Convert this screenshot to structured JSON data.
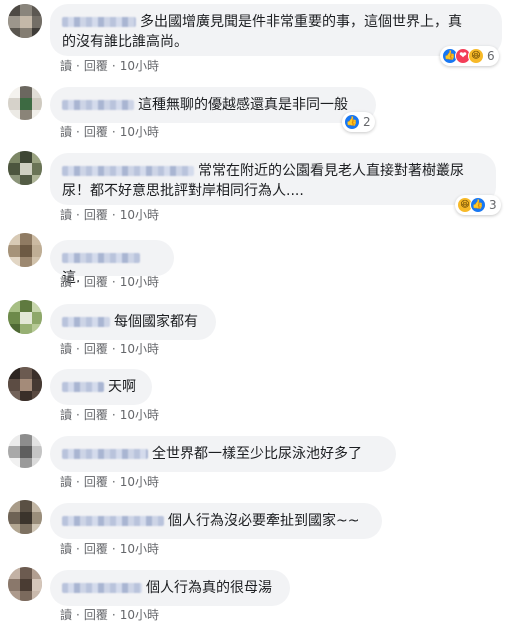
{
  "actions": {
    "read": "讀",
    "reply": "回覆",
    "separator": "·",
    "time": "10小時"
  },
  "comments": [
    {
      "text_line1": "多出國增廣見聞是件非常重要的事，這個世界上，真",
      "text_line2": "的沒有誰比誰高尚。",
      "reaction_count": "6"
    },
    {
      "text": "這種無聊的優越感還真是非同一般",
      "reaction_count": "2"
    },
    {
      "text_line1": "常常在附近的公園看見老人直接對著樹叢尿",
      "text_line2": "尿！都不好意思批評對岸相同行為人....",
      "reaction_count": "3"
    },
    {
      "text": "這."
    },
    {
      "text": "每個國家都有"
    },
    {
      "text": "天啊"
    },
    {
      "text": "全世界都一樣至少比尿泳池好多了"
    },
    {
      "text": "個人行為沒必要牽扯到國家~~"
    },
    {
      "text": "個人行為真的很母湯"
    }
  ],
  "colors": {
    "bubble": "#f2f3f5",
    "like": "#1877f2",
    "love": "#f33e58",
    "haha": "#f7b928",
    "meta": "#65676b"
  },
  "icons": {
    "like": "thumbs-up-icon",
    "love": "heart-icon",
    "haha": "laughing-face-icon"
  }
}
